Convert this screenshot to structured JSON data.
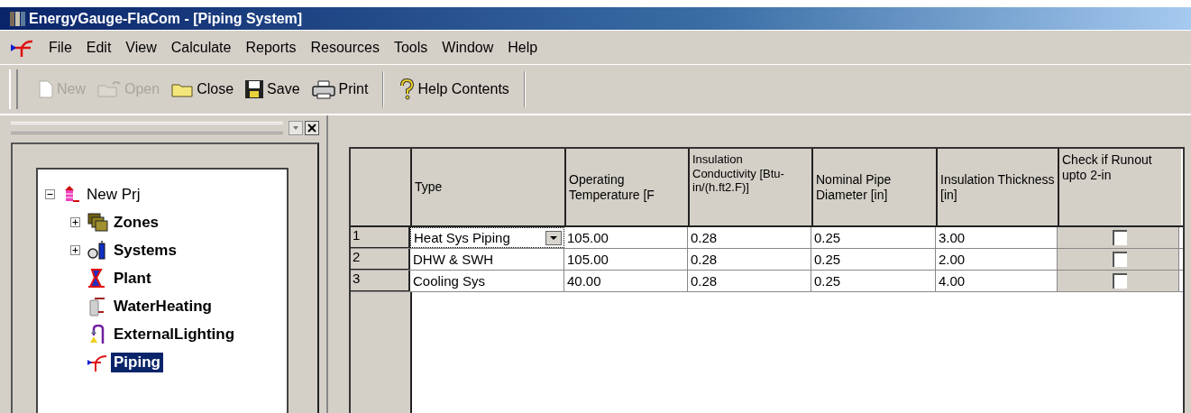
{
  "window": {
    "title": "EnergyGauge-FlaCom - [Piping System]"
  },
  "menu": [
    "File",
    "Edit",
    "View",
    "Calculate",
    "Reports",
    "Resources",
    "Tools",
    "Window",
    "Help"
  ],
  "toolbar": [
    {
      "label": "New",
      "kind": "new",
      "disabled": true
    },
    {
      "label": "Open",
      "kind": "open",
      "disabled": true
    },
    {
      "label": "Close",
      "kind": "close",
      "disabled": false
    },
    {
      "label": "Save",
      "kind": "save",
      "disabled": false
    },
    {
      "label": "Print",
      "kind": "print",
      "disabled": false
    },
    {
      "label": "Help Contents",
      "kind": "help",
      "disabled": false
    }
  ],
  "tree": [
    {
      "label": "New Prj",
      "kind": "project",
      "expanded": true,
      "selected": false,
      "children": [
        {
          "label": "Zones",
          "kind": "zones",
          "expanded": false,
          "selected": false
        },
        {
          "label": "Systems",
          "kind": "systems",
          "expanded": false,
          "selected": false
        },
        {
          "label": "Plant",
          "kind": "plant",
          "selected": false
        },
        {
          "label": "WaterHeating",
          "kind": "waterheating",
          "selected": false
        },
        {
          "label": "ExternalLighting",
          "kind": "lighting",
          "selected": false
        },
        {
          "label": "Piping",
          "kind": "piping",
          "selected": true
        }
      ]
    }
  ],
  "table": {
    "columns": [
      "Type",
      "Operating Temperature [F",
      "Insulation Conductivity [Btu-in/(h.ft2.F)]",
      "Nominal Pipe Diameter [in]",
      "Insulation Thickness [in]",
      "Check if Runout upto 2-in"
    ],
    "rows": [
      {
        "number": "1",
        "editing": true,
        "cells": [
          "Heat Sys Piping",
          "105.00",
          "0.28",
          "0.25",
          "3.00"
        ],
        "checked": false
      },
      {
        "number": "2",
        "editing": false,
        "cells": [
          "DHW & SWH",
          "105.00",
          "0.28",
          "0.25",
          "2.00"
        ],
        "checked": false
      },
      {
        "number": "3",
        "editing": false,
        "cells": [
          "Cooling Sys",
          "40.00",
          "0.28",
          "0.25",
          "4.00"
        ],
        "checked": false
      }
    ]
  }
}
